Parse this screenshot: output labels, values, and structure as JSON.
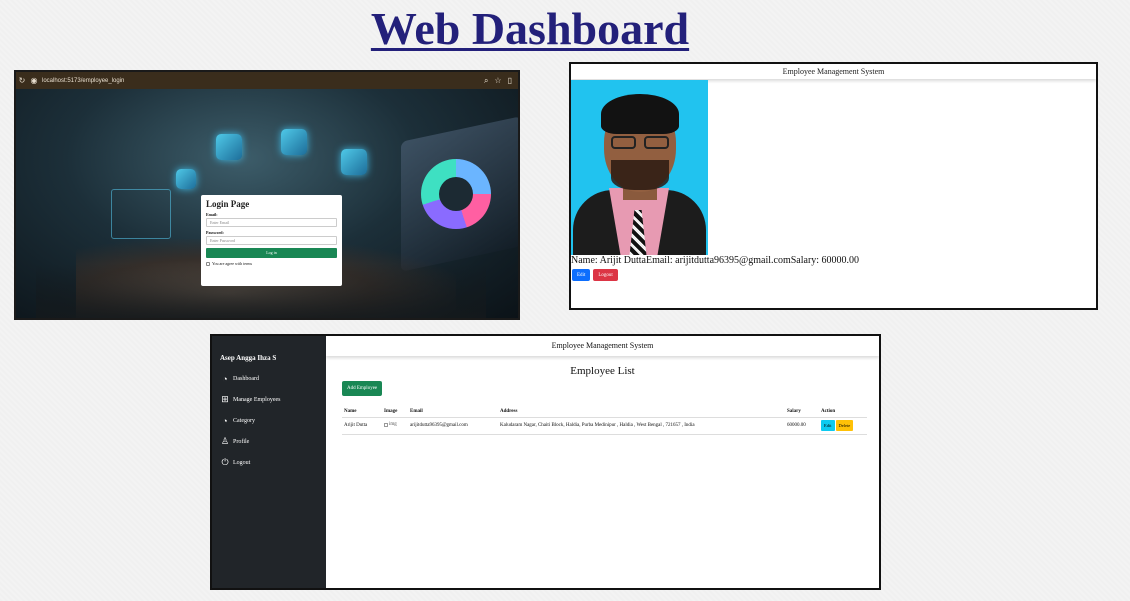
{
  "page_title": "Web Dashboard",
  "login_screen": {
    "browser": {
      "url": "localhost:5173/employee_login",
      "icons": [
        "reload-icon",
        "site-info-icon",
        "zoom-icon",
        "star-icon",
        "extensions-icon"
      ]
    },
    "card_title": "Login Page",
    "email_label": "Email:",
    "email_placeholder": "Enter Email",
    "password_label": "Password:",
    "password_placeholder": "Enter Password",
    "login_button": "Log in",
    "terms_label": "You are agree with terms",
    "colors": {
      "button": "#198754"
    }
  },
  "employee_detail": {
    "header": "Employee Management System",
    "info_text": "Name: Arijit DuttaEmail: arijitdutta96395@gmail.comSalary: 60000.00",
    "edit_button": "Edit",
    "logout_button": "Logout",
    "colors": {
      "edit": "#0d6efd",
      "logout": "#dc3545",
      "photo_bg": "#21c3ef"
    }
  },
  "employee_list": {
    "header": "Employee Management System",
    "sidebar": {
      "brand": "Asep Angga Ihza S",
      "items": [
        {
          "label": "Dashboard",
          "icon": "speedometer-icon"
        },
        {
          "label": "Manage Employees",
          "icon": "grid-icon"
        },
        {
          "label": "Category",
          "icon": "gauge-icon"
        },
        {
          "label": "Profile",
          "icon": "person-icon"
        },
        {
          "label": "Logout",
          "icon": "power-icon"
        }
      ]
    },
    "title": "Employee List",
    "add_button": "Add Employee",
    "columns": [
      "Name",
      "Image",
      "Email",
      "Address",
      "Salary",
      "Action"
    ],
    "rows": [
      {
        "name": "Arijit Dutta",
        "image_alt": "img",
        "email": "arijitdutta96395@gmail.com",
        "address": "Kaludaram Nagar, Chaiti Block, Haldia, Purba Medinipur , Haldia , West Bengal , 721657 , India",
        "salary": "60000.00",
        "edit": "Edit",
        "delete": "Delete"
      }
    ],
    "colors": {
      "sidebar": "#212529",
      "add": "#198754",
      "edit": "#0dcaf0",
      "delete": "#ffc107"
    }
  }
}
